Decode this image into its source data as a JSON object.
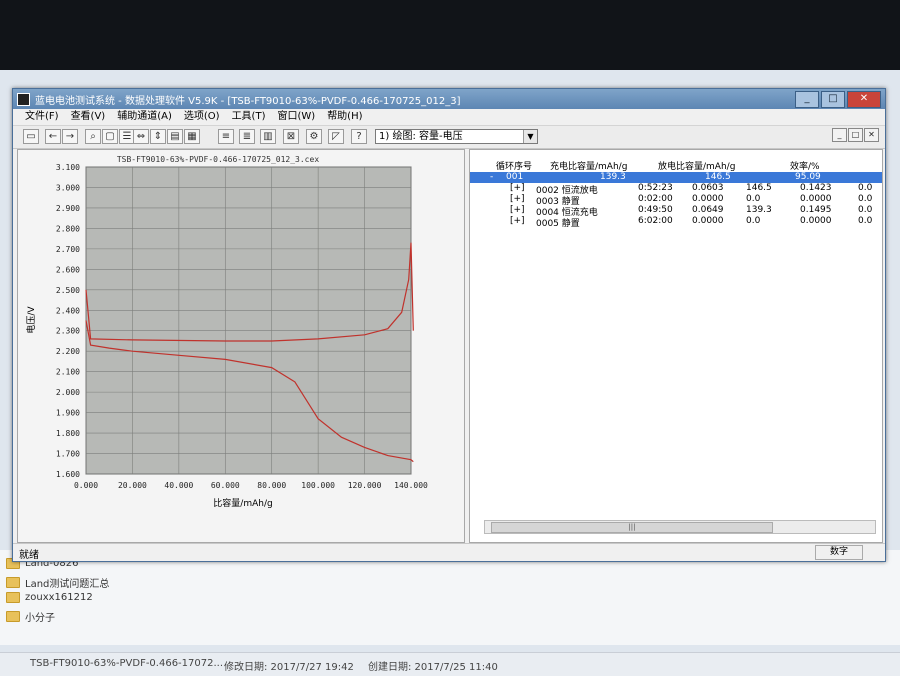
{
  "window": {
    "title": "蓝电电池测试系统 - 数据处理软件 V5.9K - [TSB-FT9010-63%-PVDF-0.466-170725_012_3]",
    "controls": [
      "_",
      "□",
      "✕"
    ]
  },
  "menu": [
    "文件(F)",
    "查看(V)",
    "辅助通道(A)",
    "选项(O)",
    "工具(T)",
    "窗口(W)",
    "帮助(H)"
  ],
  "toolbar": {
    "plot_select": "1) 绘图: 容量-电压"
  },
  "mdi_controls": [
    "_",
    "□",
    "✕"
  ],
  "chart_data": {
    "type": "line",
    "title": "TSB-FT9010-63%-PVDF-0.466-170725_012_3.cex",
    "xlabel": "比容量/mAh/g",
    "ylabel": "电压/V",
    "xlim": [
      0,
      140
    ],
    "ylim": [
      1.6,
      3.1
    ],
    "x_ticks": [
      "0.000",
      "20.000",
      "40.000",
      "60.000",
      "80.000",
      "100.000",
      "120.000",
      "140.000"
    ],
    "y_ticks": [
      "3.100",
      "3.000",
      "2.900",
      "2.800",
      "2.700",
      "2.600",
      "2.500",
      "2.400",
      "2.300",
      "2.200",
      "2.100",
      "2.000",
      "1.900",
      "1.800",
      "1.700",
      "1.600"
    ],
    "grid": true,
    "series": [
      {
        "color": "#c0322c",
        "x": [
          0,
          2,
          10,
          20,
          40,
          60,
          80,
          90,
          95,
          100,
          110,
          120,
          130,
          140,
          141
        ],
        "y": [
          2.35,
          2.23,
          2.215,
          2.2,
          2.18,
          2.16,
          2.12,
          2.05,
          1.96,
          1.87,
          1.78,
          1.73,
          1.69,
          1.67,
          1.66
        ]
      },
      {
        "color": "#c0322c",
        "x": [
          0,
          2,
          20,
          60,
          80,
          100,
          120,
          130,
          136,
          139,
          140,
          141
        ],
        "y": [
          2.5,
          2.26,
          2.255,
          2.25,
          2.25,
          2.26,
          2.28,
          2.31,
          2.39,
          2.55,
          2.73,
          2.3
        ]
      }
    ]
  },
  "table": {
    "headers": [
      "循环序号",
      "充电比容量/mAh/g",
      "放电比容量/mAh/g",
      "效率/%"
    ],
    "selected_row": [
      "-",
      "001",
      "139.3",
      "146.5",
      "95.09"
    ],
    "rows": [
      {
        "expand": "[+]",
        "step": "0002 恒流放电",
        "time": "0:52:23",
        "v1": "0.0603",
        "v2": "146.5",
        "v3": "0.1423",
        "v4": "0.0"
      },
      {
        "expand": "[+]",
        "step": "0003 静置",
        "time": "0:02:00",
        "v1": "0.0000",
        "v2": "0.0",
        "v3": "0.0000",
        "v4": "0.0"
      },
      {
        "expand": "[+]",
        "step": "0004 恒流充电",
        "time": "0:49:50",
        "v1": "0.0649",
        "v2": "139.3",
        "v3": "0.1495",
        "v4": "0.0"
      },
      {
        "expand": "[+]",
        "step": "0005 静置",
        "time": "6:02:00",
        "v1": "0.0000",
        "v2": "0.0",
        "v3": "0.0000",
        "v4": "0.0"
      }
    ]
  },
  "statusbar": {
    "left": "就绪",
    "right": "数字"
  },
  "explorer": {
    "items": [
      "Land-0826",
      "Land测试问题汇总",
      "zouxx161212",
      "小分子"
    ],
    "file_name": "TSB-FT9010-63%-PVDF-0.466-17072...",
    "modified": "修改日期: 2017/7/27 19:42",
    "created": "创建日期: 2017/7/25 11:40"
  }
}
